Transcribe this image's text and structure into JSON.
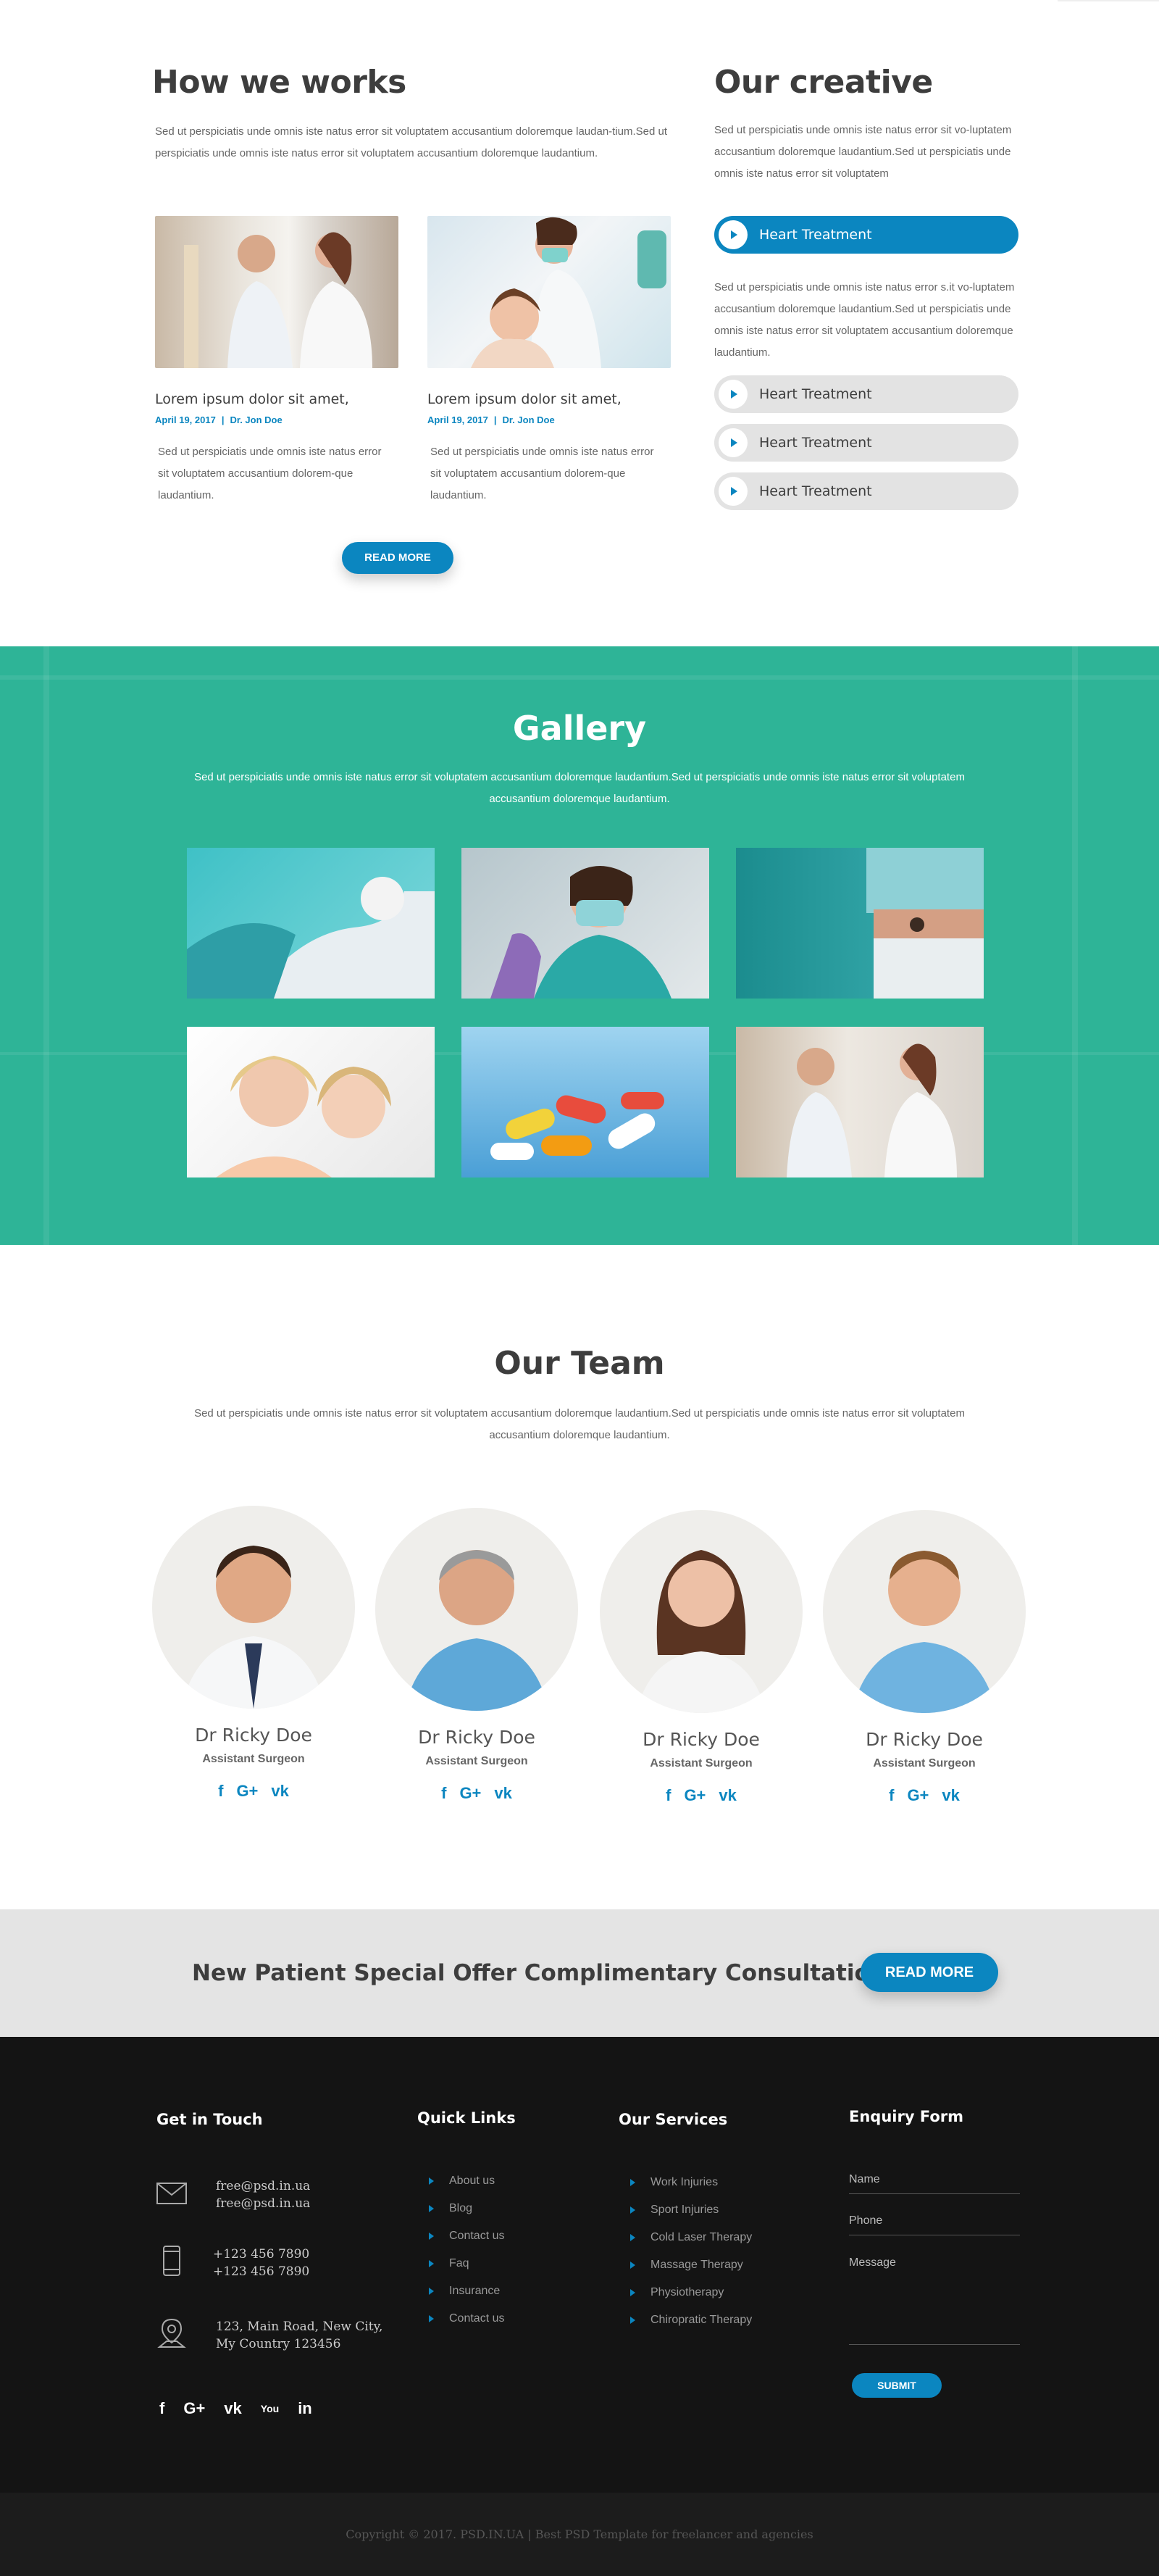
{
  "works": {
    "title": "How we works",
    "intro": "Sed ut perspiciatis unde omnis iste natus error sit voluptatem accusantium doloremque laudan-tium.Sed ut perspiciatis unde omnis iste natus error sit voluptatem accusantium doloremque laudantium.",
    "cards": [
      {
        "title": "Lorem ipsum dolor sit amet,",
        "date": "April 19, 2017",
        "sep": "|",
        "author": "Dr. Jon Doe",
        "text": "Sed ut perspiciatis unde omnis iste natus error sit voluptatem accusantium dolorem-que laudantium."
      },
      {
        "title": "Lorem ipsum dolor sit amet,",
        "date": "April 19, 2017",
        "sep": "|",
        "author": "Dr. Jon Doe",
        "text": "Sed ut perspiciatis unde omnis iste natus error sit voluptatem accusantium dolorem-que laudantium."
      }
    ],
    "read_more": "READ MORE"
  },
  "creative": {
    "title": "Our creative",
    "intro": "Sed ut perspiciatis unde omnis iste natus error sit vo-luptatem accusantium doloremque laudantium.Sed ut perspiciatis unde omnis iste natus error sit voluptatem",
    "items": [
      {
        "label": "Heart Treatment",
        "active": true
      },
      {
        "label": "Heart Treatment",
        "active": false
      },
      {
        "label": "Heart Treatment",
        "active": false
      },
      {
        "label": "Heart Treatment",
        "active": false
      }
    ],
    "active_body": "Sed ut perspiciatis unde omnis iste natus error s.it vo-luptatem accusantium doloremque laudantium.Sed ut perspiciatis unde omnis iste natus error sit voluptatem accusantium doloremque laudantium."
  },
  "gallery": {
    "title": "Gallery",
    "intro": "Sed ut perspiciatis unde omnis iste natus error sit voluptatem accusantium doloremque laudantium.Sed ut perspiciatis unde omnis iste natus error sit voluptatem accusantium doloremque laudantium.",
    "images": [
      "dental-treatment",
      "dentist-with-mask",
      "surgeon-in-cap",
      "mother-and-daughter",
      "pills",
      "doctor-consultation"
    ]
  },
  "team": {
    "title": "Our Team",
    "intro": "Sed ut perspiciatis unde omnis iste natus error sit voluptatem accusantium doloremque laudantium.Sed ut perspiciatis unde omnis iste natus error sit voluptatem accusantium doloremque laudantium.",
    "members": [
      {
        "name": "Dr Ricky Doe",
        "role": "Assistant Surgeon"
      },
      {
        "name": "Dr Ricky Doe",
        "role": "Assistant Surgeon"
      },
      {
        "name": "Dr Ricky Doe",
        "role": "Assistant Surgeon"
      },
      {
        "name": "Dr Ricky Doe",
        "role": "Assistant Surgeon"
      }
    ],
    "social": {
      "facebook": "f",
      "google": "G+",
      "vk": "vk"
    }
  },
  "offer": {
    "text": "New Patient Special Offer Complimentary Consultation",
    "button": "READ MORE"
  },
  "footer": {
    "touch": {
      "title": "Get in Touch",
      "email1": "free@psd.in.ua",
      "email2": "free@psd.in.ua",
      "phone1": "+123 456 7890",
      "phone2": "+123 456 7890",
      "address1": "123, Main Road, New City,",
      "address2": "My Country 123456",
      "social": {
        "facebook": "f",
        "google": "G+",
        "vk": "vk",
        "youtube": "You",
        "linkedin": "in"
      }
    },
    "quick": {
      "title": "Quick Links",
      "links": [
        "About us",
        "Blog",
        "Contact us",
        "Faq",
        "Insurance",
        "Contact us"
      ]
    },
    "services": {
      "title": "Our Services",
      "links": [
        "Work Injuries",
        "Sport Injuries",
        "Cold Laser Therapy",
        "Massage Therapy",
        "Physiotherapy",
        "Chiropratic Therapy"
      ]
    },
    "enquiry": {
      "title": "Enquiry Form",
      "name_label": "Name",
      "phone_label": "Phone",
      "message_label": "Message",
      "submit": "SUBMIT"
    }
  },
  "copyright": "Copyright © 2017. PSD.IN.UA  | Best PSD Template for freelancer and agencies",
  "colors": {
    "accent": "#0b86c0",
    "gallery_bg": "#2eb497",
    "footer_bg": "#141414",
    "offer_bg": "#e4e4e4"
  }
}
